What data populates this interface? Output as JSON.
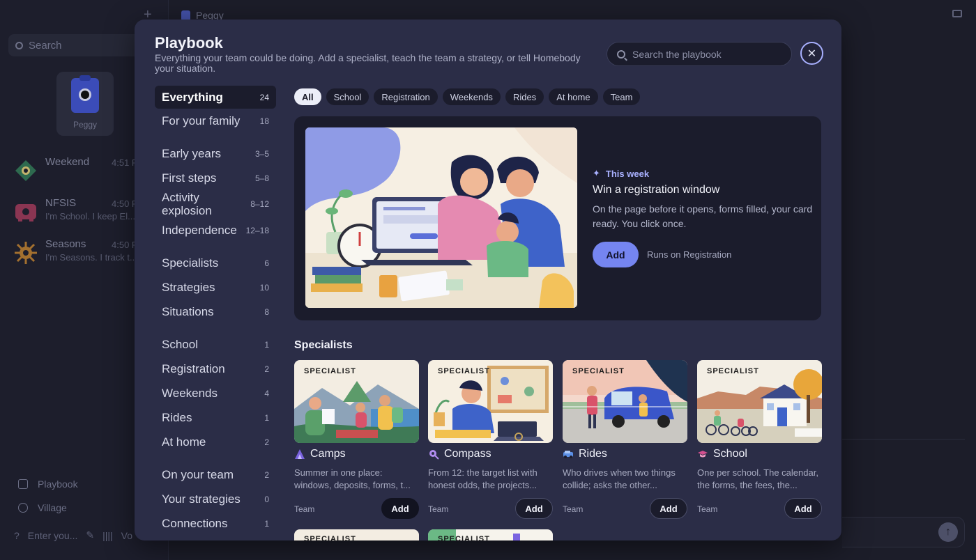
{
  "background": {
    "tab_title": "Peggy",
    "search_placeholder": "Search",
    "pinned_name": "Peggy",
    "chats": [
      {
        "name": "Weekend",
        "time": "4:51 P",
        "preview": ""
      },
      {
        "name": "NFSIS",
        "time": "4:50 P",
        "preview": "I'm School. I keep El..."
      },
      {
        "name": "Seasons",
        "time": "4:50 P",
        "preview": "I'm Seasons. I track t..."
      }
    ],
    "bottom_items": [
      "Playbook",
      "Village"
    ],
    "compose_placeholder": "Enter you...",
    "voice_label": "Vo"
  },
  "modal": {
    "title": "Playbook",
    "subtitle": "Everything your team could be doing. Add a specialist, teach the team a strategy, or tell Homebody your situation.",
    "search_placeholder": "Search the playbook",
    "nav": [
      {
        "label": "Everything",
        "count": "24",
        "active": true
      },
      {
        "label": "For your family",
        "count": "18"
      },
      {
        "gap": true
      },
      {
        "label": "Early years",
        "count": "3–5"
      },
      {
        "label": "First steps",
        "count": "5–8"
      },
      {
        "label": "Activity explosion",
        "count": "8–12",
        "tall": true
      },
      {
        "label": "Independence",
        "count": "12–18"
      },
      {
        "gap": true
      },
      {
        "label": "Specialists",
        "count": "6"
      },
      {
        "label": "Strategies",
        "count": "10"
      },
      {
        "label": "Situations",
        "count": "8"
      },
      {
        "gap": true
      },
      {
        "label": "School",
        "count": "1"
      },
      {
        "label": "Registration",
        "count": "2"
      },
      {
        "label": "Weekends",
        "count": "4"
      },
      {
        "label": "Rides",
        "count": "1"
      },
      {
        "label": "At home",
        "count": "2"
      },
      {
        "gap": true
      },
      {
        "label": "On your team",
        "count": "2"
      },
      {
        "label": "Your strategies",
        "count": "0"
      },
      {
        "label": "Connections",
        "count": "1"
      }
    ],
    "filters": [
      "All",
      "School",
      "Registration",
      "Weekends",
      "Rides",
      "At home",
      "Team"
    ],
    "hero": {
      "tag": "This week",
      "title": "Win a registration window",
      "description": "On the page before it opens, forms filled, your card ready. You click once.",
      "add_label": "Add",
      "runs_on": "Runs on Registration"
    },
    "section_title": "Specialists",
    "badge_label": "SPECIALIST",
    "team_label": "Team",
    "add_label": "Add",
    "cards": [
      {
        "name": "Camps",
        "icon": "camp-tent-icon",
        "description": "Summer in one place: windows, deposits, forms, t..."
      },
      {
        "name": "Compass",
        "icon": "compass-pin-icon",
        "description": "From 12: the target list with honest odds, the projects..."
      },
      {
        "name": "Rides",
        "icon": "car-icon",
        "description": "Who drives when two things collide; asks the other..."
      },
      {
        "name": "School",
        "icon": "graduation-cap-icon",
        "description": "One per school. The calendar, the forms, the fees, the..."
      }
    ]
  },
  "colors": {
    "accent": "#7585f0",
    "modal_bg": "#2b2d47",
    "panel_bg": "#1b1c2c"
  }
}
